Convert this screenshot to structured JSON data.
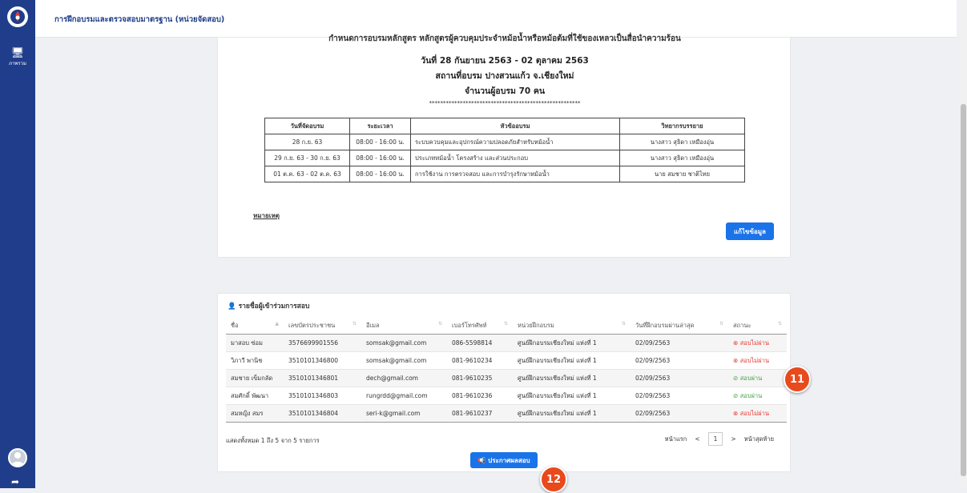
{
  "header": {
    "title": "การฝึกอบรมและตรวจสอบมาตรฐาน (หน่วยจัดสอบ)"
  },
  "sidebar": {
    "nav_label": "ภาพรวม"
  },
  "course": {
    "cut_header": "กำหนดการอบรมหลักสูตร  หลักสูตรผู้ควบคุมประจำหม้อน้ำหรือหม้อต้มที่ใช้ของเหลวเป็นสื่อนำความร้อน",
    "date_line": "วันที่ 28 กันยายน 2563 - 02 ตุลาคม 2563",
    "place_line": "สถานที่อบรม ปางสวนแก้ว จ.เชียงใหม่",
    "count_line": "จำนวนผู้อบรม 70 คน",
    "stars": "******************************************************",
    "schedule_headers": [
      "วันที่จัดอบรม",
      "ระยะเวลา",
      "หัวข้ออบรม",
      "วิทยากรบรรยาย"
    ],
    "schedule_rows": [
      [
        "28 ก.ย. 63",
        "08:00 - 16:00 น.",
        "ระบบควบคุมและอุปกรณ์ความปลอดภัยสำหรับหม้อน้ำ",
        "นางสาว สุธิดา เหมืองอุ่น"
      ],
      [
        "29 ก.ย. 63 - 30 ก.ย. 63",
        "08:00 - 16:00 น.",
        "ประเภทหม้อน้ำ โครงสร้าง และส่วนประกอบ",
        "นางสาว สุธิดา เหมืองอุ่น"
      ],
      [
        "01 ต.ค. 63 - 02 ต.ค. 63",
        "08:00 - 16:00 น.",
        "การใช้งาน การตรวจสอบ และการบำรุงรักษาหม้อน้ำ",
        "นาย สมชาย ชาติไทย"
      ]
    ],
    "note_label": "หมายเหตุ",
    "edit_button": "แก้ไขข้อมูล"
  },
  "participants": {
    "title": "รายชื่อผู้เข้าร่วมการสอบ",
    "headers": [
      "ชื่อ",
      "เลขบัตรประชาชน",
      "อีเมล",
      "เบอร์โทรศัพท์",
      "หน่วยฝึกอบรม",
      "วันที่ฝึกอบรมผ่านล่าสุด",
      "สถานะ"
    ],
    "rows": [
      [
        "มาสอบ ซ่อม",
        "3576699901556",
        "somsak@gmail.com",
        "086-5598814",
        "ศูนย์ฝึกอบรมเชียงใหม่ แห่งที่ 1",
        "02/09/2563",
        "สอบไม่ผ่าน"
      ],
      [
        "วิภาวี พานิช",
        "3510101346800",
        "somsak@gmail.com",
        "081-9610234",
        "ศูนย์ฝึกอบรมเชียงใหม่ แห่งที่ 1",
        "02/09/2563",
        "สอบไม่ผ่าน"
      ],
      [
        "สมชาย เข็มกลัด",
        "3510101346801",
        "dech@gmail.com",
        "081-9610235",
        "ศูนย์ฝึกอบรมเชียงใหม่ แห่งที่ 1",
        "02/09/2563",
        "สอบผ่าน"
      ],
      [
        "สมศักดิ์ พัฒนา",
        "3510101346803",
        "rungrdd@gmail.com",
        "081-9610236",
        "ศูนย์ฝึกอบรมเชียงใหม่ แห่งที่ 1",
        "02/09/2563",
        "สอบผ่าน"
      ],
      [
        "สมหญิง สมร",
        "3510101346804",
        "seri-k@gmail.com",
        "081-9610237",
        "ศูนย์ฝึกอบรมเชียงใหม่ แห่งที่ 1",
        "02/09/2563",
        "สอบไม่ผ่าน"
      ]
    ],
    "info": "แสดงทั้งหมด 1 ถึง 5 จาก 5 รายการ",
    "pager": {
      "first": "หน้าแรก",
      "prev": "<",
      "page": "1",
      "next": ">",
      "last": "หน้าสุดท้าย"
    },
    "announce_button": "ประกาศผลสอบ"
  },
  "markers": {
    "m11": "11",
    "m12": "12"
  },
  "colors": {
    "brand": "#1f3d8a",
    "button": "#1a73e8",
    "fail": "#e53935",
    "pass": "#43a047",
    "marker": "#e8491d"
  }
}
